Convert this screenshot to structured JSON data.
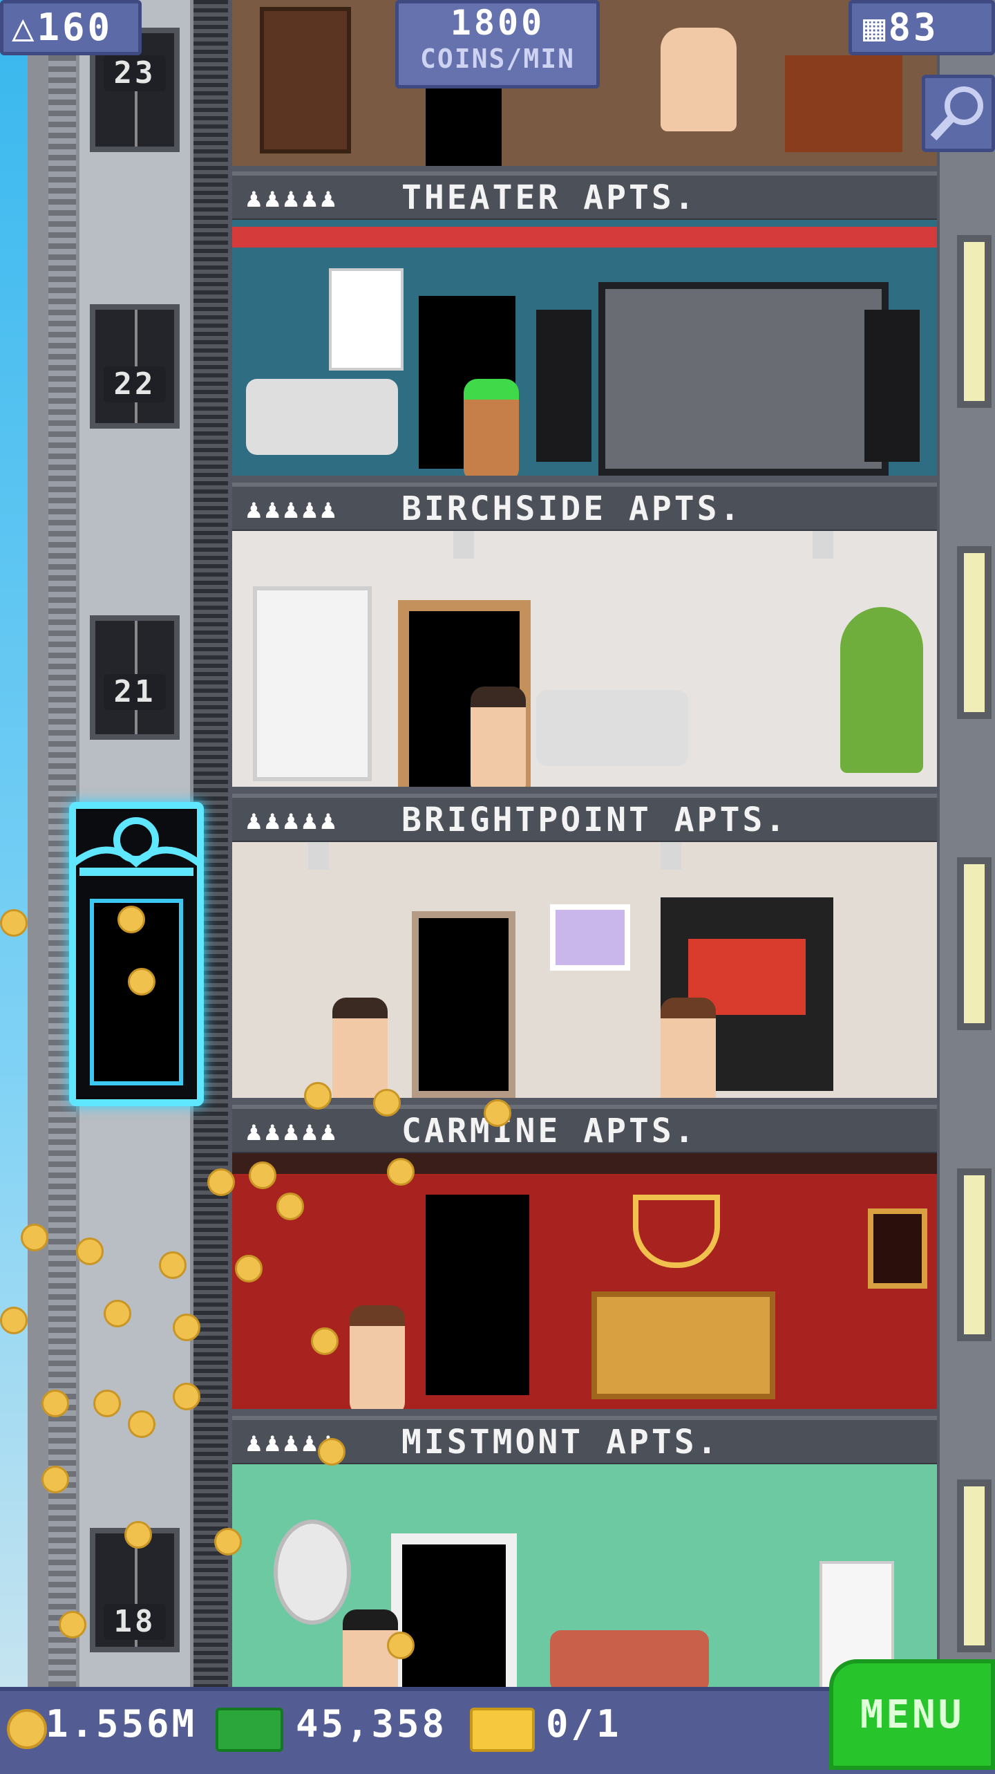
{
  "hud": {
    "population": "160",
    "coins_per_min_value": "1800",
    "coins_per_min_unit": "COINS/MIN",
    "floor_count": "83",
    "population_icon": "person-up-icon",
    "floors_icon": "building-icon",
    "search_icon": "magnifier-icon"
  },
  "elevator": {
    "floor_numbers": [
      "23",
      "22",
      "21",
      "18"
    ],
    "color": "#5fe7ff"
  },
  "floors": [
    {
      "name": "THEATER APTS.",
      "residents": "♟♟♟♟♟",
      "wall": "#2f6e82"
    },
    {
      "name": "BIRCHSIDE APTS.",
      "residents": "♟♟♟♟♟",
      "wall": "#e6e3e0"
    },
    {
      "name": "BRIGHTPOINT APTS.",
      "residents": "♟♟♟♟♟",
      "wall": "#e3dcd4"
    },
    {
      "name": "CARMINE APTS.",
      "residents": "♟♟♟♟♟",
      "wall": "#a8231f"
    },
    {
      "name": "MISTMONT APTS.",
      "residents": "♟♟♟♟♟",
      "wall": "#6dc9a2"
    }
  ],
  "bottom_bar": {
    "coins": "1.556M",
    "bux": "45,358",
    "vip": "0/1",
    "menu_label": "MENU",
    "coin_icon": "coin-icon",
    "bux_icon": "bux-icon",
    "vip_icon": "golden-ticket-icon"
  }
}
